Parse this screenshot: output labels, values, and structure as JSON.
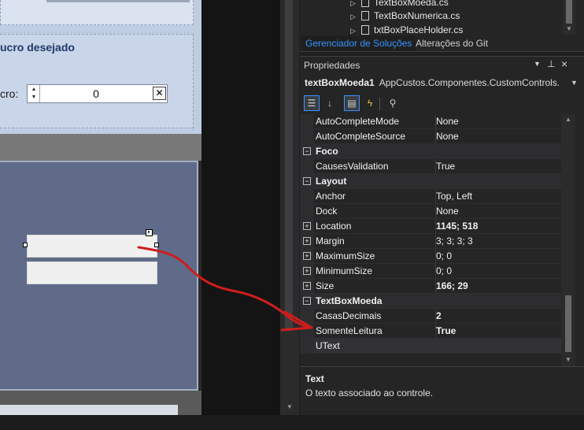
{
  "designer": {
    "group_title": "ucro desejado",
    "lucro_label": "cro:",
    "lucro_value": "0",
    "clear_glyph": "✕",
    "spin_up_glyph": "▲",
    "spin_down_glyph": "▼",
    "smart_tag_glyph": "▸"
  },
  "solution_explorer": {
    "files": [
      {
        "name": "TextBoxMoeda.cs"
      },
      {
        "name": "TextBoxNumerica.cs"
      },
      {
        "name": "txtBoxPlaceHolder.cs"
      }
    ],
    "tabs": {
      "solutions": "Gerenciador de Soluções",
      "git": "Alterações do Git"
    }
  },
  "properties": {
    "title": "Propriedades",
    "object_name": "textBoxMoeda1",
    "object_type": "AppCustos.Componentes.CustomControls.",
    "icons": {
      "dropdown": "chevron-down-icon",
      "pin": "pin-icon",
      "close": "close-icon",
      "categorized": "categorized-icon",
      "alphabetical": "sort-alpha-icon",
      "properties": "properties-icon",
      "events": "lightning-icon",
      "property_pages": "wrench-icon"
    },
    "rows": [
      {
        "kind": "prop",
        "name": "AutoCompleteMode",
        "value": "None"
      },
      {
        "kind": "prop",
        "name": "AutoCompleteSource",
        "value": "None"
      },
      {
        "kind": "cat",
        "name": "Foco"
      },
      {
        "kind": "prop",
        "name": "CausesValidation",
        "value": "True"
      },
      {
        "kind": "cat",
        "name": "Layout"
      },
      {
        "kind": "prop",
        "name": "Anchor",
        "value": "Top, Left"
      },
      {
        "kind": "prop",
        "name": "Dock",
        "value": "None"
      },
      {
        "kind": "expandable",
        "name": "Location",
        "value": "1145; 518",
        "bold": true
      },
      {
        "kind": "expandable",
        "name": "Margin",
        "value": "3; 3; 3; 3"
      },
      {
        "kind": "expandable",
        "name": "MaximumSize",
        "value": "0; 0"
      },
      {
        "kind": "expandable",
        "name": "MinimumSize",
        "value": "0; 0"
      },
      {
        "kind": "expandable",
        "name": "Size",
        "value": "166; 29",
        "bold": true
      },
      {
        "kind": "cat",
        "name": "TextBoxMoeda"
      },
      {
        "kind": "prop",
        "name": "CasasDecimais",
        "value": "2",
        "bold": true
      },
      {
        "kind": "prop",
        "name": "SomenteLeitura",
        "value": "True",
        "bold": true
      },
      {
        "kind": "prop",
        "name": "UText",
        "value": "",
        "selected": true
      }
    ],
    "description": {
      "title": "Text",
      "text": "O texto associado ao controle."
    }
  },
  "colors": {
    "accent": "#3794ff",
    "annotation": "#d01c1c",
    "panel_bg": "#252526"
  }
}
